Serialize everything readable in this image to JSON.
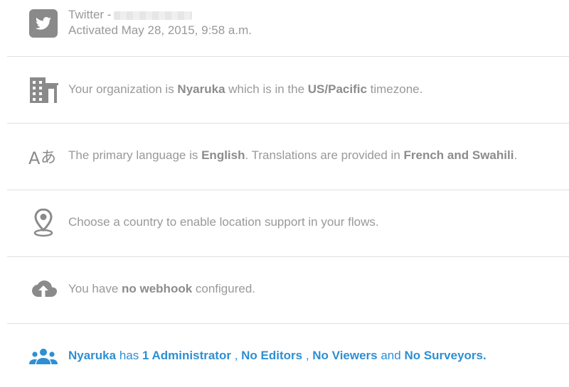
{
  "channel": {
    "name": "Twitter -",
    "activated": "Activated May 28, 2015, 9:58 a.m.",
    "icon": "twitter-icon"
  },
  "organization": {
    "prefix": "Your organization is ",
    "name": "Nyaruka",
    "middle": " which is in the ",
    "timezone": "US/Pacific",
    "suffix": " timezone.",
    "icon": "building-icon"
  },
  "language": {
    "prefix": "The primary language is ",
    "primary": "English",
    "middle": ". Translations are provided in ",
    "translations": "French and Swahili",
    "suffix": ".",
    "icon": "translate-icon"
  },
  "location": {
    "text": "Choose a country to enable location support in your flows.",
    "icon": "location-pin-icon"
  },
  "webhook": {
    "prefix": "You have ",
    "value": "no webhook",
    "suffix": " configured.",
    "icon": "cloud-upload-icon"
  },
  "users": {
    "org": "Nyaruka",
    "has": " has ",
    "admins": "1 Administrator",
    "sep1": " , ",
    "editors": "No Editors",
    "sep2": " , ",
    "viewers": "No Viewers",
    "and": " and ",
    "surveyors": "No Surveyors.",
    "icon": "users-icon",
    "link_color": "#2e8fd3"
  }
}
